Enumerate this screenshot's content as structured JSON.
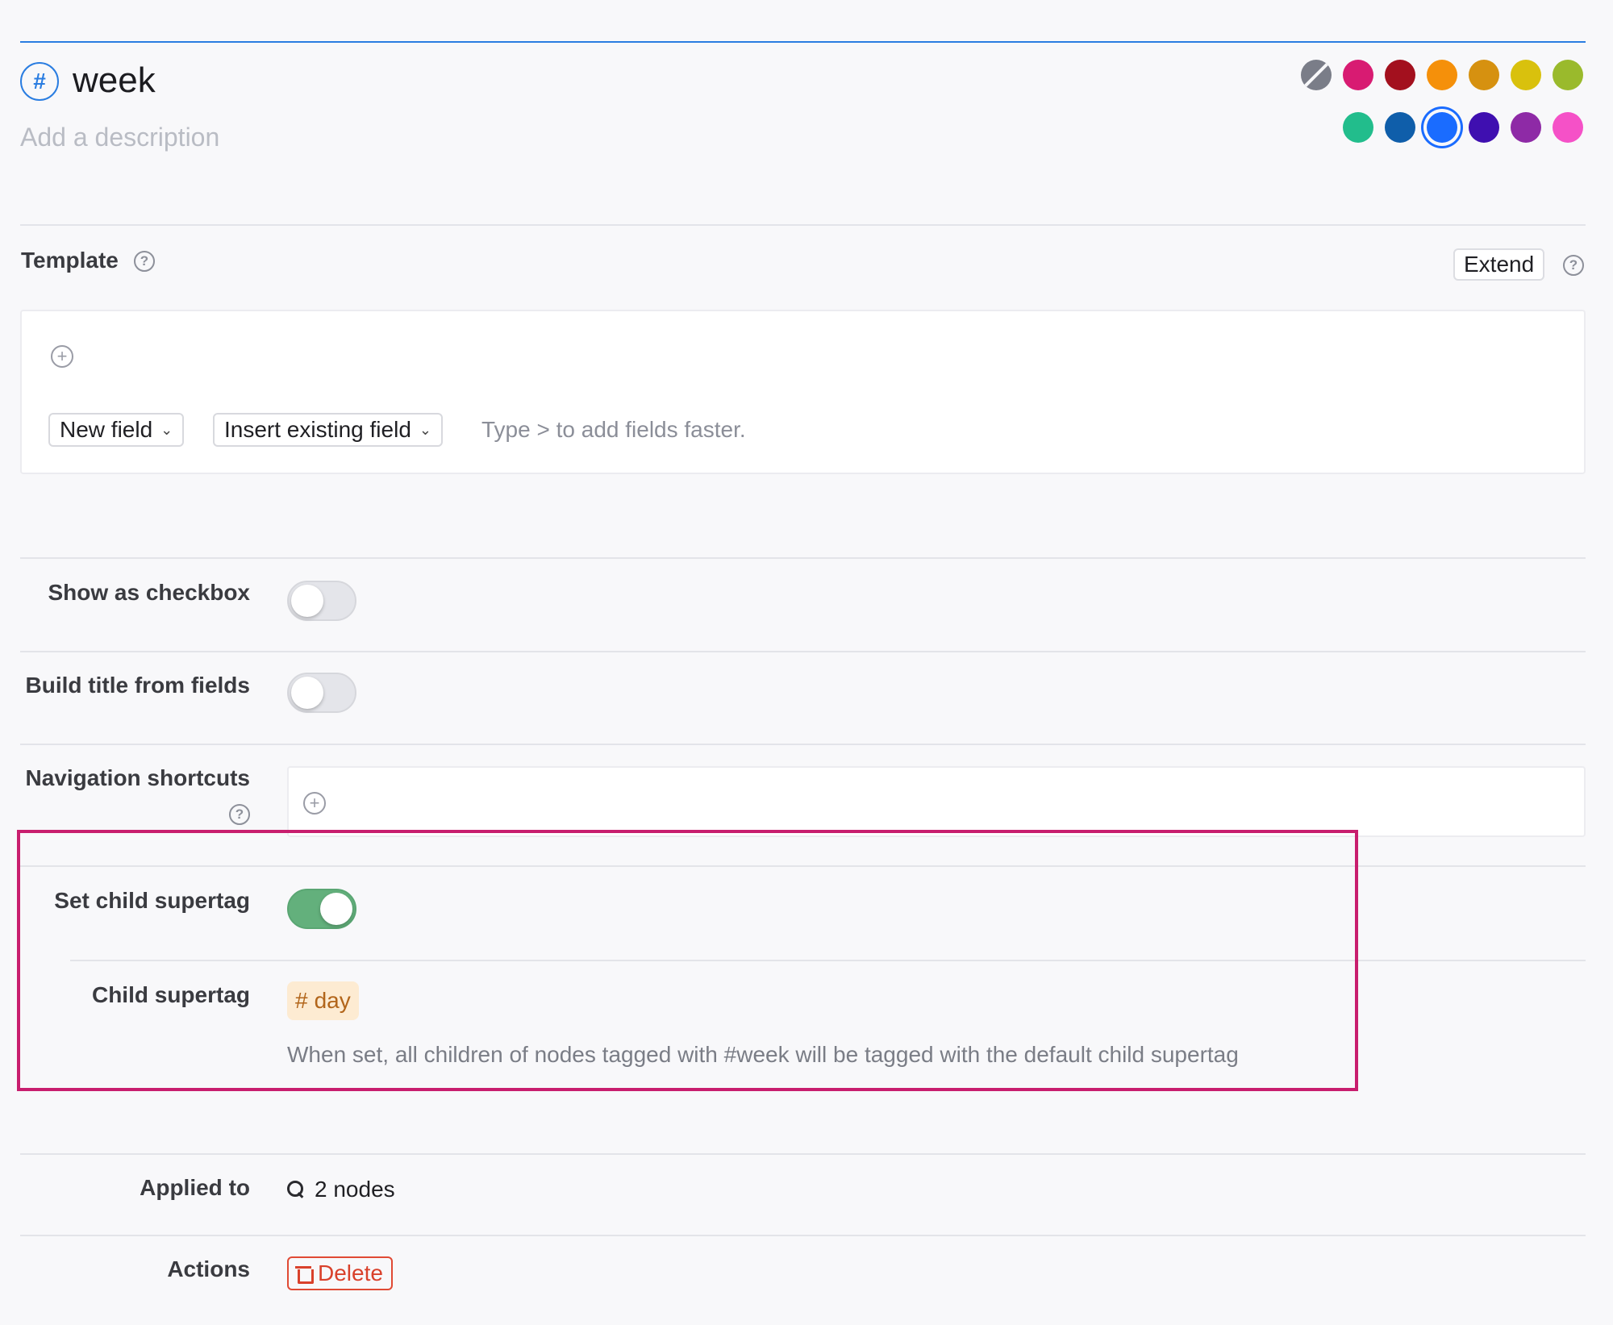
{
  "header": {
    "hash_symbol": "#",
    "title": "week",
    "description_placeholder": "Add a description"
  },
  "colors": {
    "accent": "#2a7de1",
    "swatches_row1": [
      "none",
      "#d81b72",
      "#a3101e",
      "#f5900a",
      "#d69110",
      "#d9c10d",
      "#9aba2c"
    ],
    "swatches_row2": [
      "#22bd8c",
      "#0f5eaa",
      "#1a6cff",
      "#3f0fb0",
      "#8e2aa6",
      "#f551c7"
    ],
    "selected": "#1a6cff",
    "toggle_on": "#63b07c",
    "highlight_border": "#c81e6e"
  },
  "template": {
    "label": "Template",
    "help": "?",
    "extend_label": "Extend",
    "add_icon": "+",
    "new_field_label": "New field",
    "insert_existing_label": "Insert existing field",
    "hint": "Type > to add fields faster."
  },
  "settings": {
    "show_as_checkbox": {
      "label": "Show as checkbox",
      "enabled": false
    },
    "build_title": {
      "label": "Build title from fields",
      "enabled": false
    },
    "nav_shortcuts": {
      "label": "Navigation shortcuts",
      "help": "?",
      "add_icon": "+"
    },
    "set_child_supertag": {
      "label": "Set child supertag",
      "enabled": true
    },
    "child_supertag": {
      "label": "Child supertag",
      "chip_hash": "#",
      "chip_name": "day",
      "note": "When set, all children of nodes tagged with #week will be tagged with the default child supertag"
    },
    "applied_to": {
      "label": "Applied to",
      "value": "2 nodes"
    },
    "actions": {
      "label": "Actions",
      "delete_label": "Delete"
    }
  }
}
